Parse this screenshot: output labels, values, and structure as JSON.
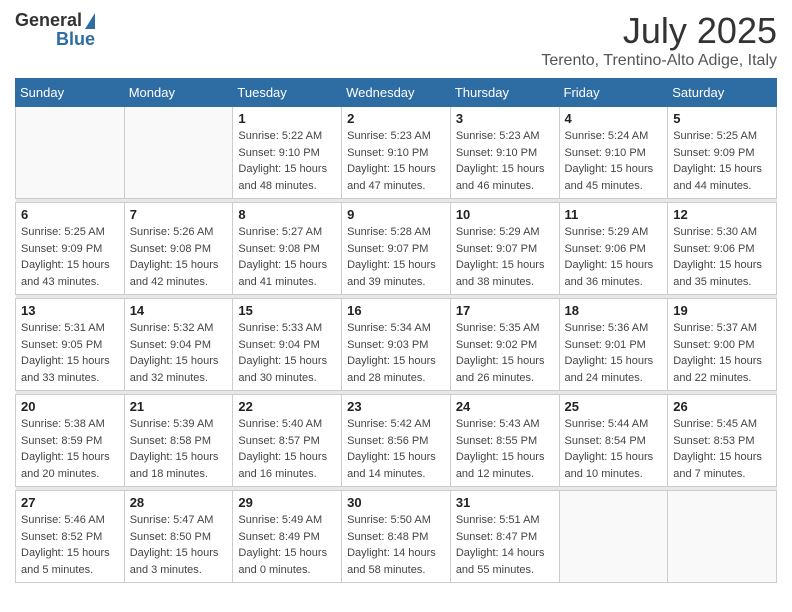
{
  "header": {
    "logo_general": "General",
    "logo_blue": "Blue",
    "month_title": "July 2025",
    "location": "Terento, Trentino-Alto Adige, Italy"
  },
  "days_of_week": [
    "Sunday",
    "Monday",
    "Tuesday",
    "Wednesday",
    "Thursday",
    "Friday",
    "Saturday"
  ],
  "weeks": [
    {
      "days": [
        {
          "num": "",
          "info": ""
        },
        {
          "num": "",
          "info": ""
        },
        {
          "num": "1",
          "info": "Sunrise: 5:22 AM\nSunset: 9:10 PM\nDaylight: 15 hours\nand 48 minutes."
        },
        {
          "num": "2",
          "info": "Sunrise: 5:23 AM\nSunset: 9:10 PM\nDaylight: 15 hours\nand 47 minutes."
        },
        {
          "num": "3",
          "info": "Sunrise: 5:23 AM\nSunset: 9:10 PM\nDaylight: 15 hours\nand 46 minutes."
        },
        {
          "num": "4",
          "info": "Sunrise: 5:24 AM\nSunset: 9:10 PM\nDaylight: 15 hours\nand 45 minutes."
        },
        {
          "num": "5",
          "info": "Sunrise: 5:25 AM\nSunset: 9:09 PM\nDaylight: 15 hours\nand 44 minutes."
        }
      ]
    },
    {
      "days": [
        {
          "num": "6",
          "info": "Sunrise: 5:25 AM\nSunset: 9:09 PM\nDaylight: 15 hours\nand 43 minutes."
        },
        {
          "num": "7",
          "info": "Sunrise: 5:26 AM\nSunset: 9:08 PM\nDaylight: 15 hours\nand 42 minutes."
        },
        {
          "num": "8",
          "info": "Sunrise: 5:27 AM\nSunset: 9:08 PM\nDaylight: 15 hours\nand 41 minutes."
        },
        {
          "num": "9",
          "info": "Sunrise: 5:28 AM\nSunset: 9:07 PM\nDaylight: 15 hours\nand 39 minutes."
        },
        {
          "num": "10",
          "info": "Sunrise: 5:29 AM\nSunset: 9:07 PM\nDaylight: 15 hours\nand 38 minutes."
        },
        {
          "num": "11",
          "info": "Sunrise: 5:29 AM\nSunset: 9:06 PM\nDaylight: 15 hours\nand 36 minutes."
        },
        {
          "num": "12",
          "info": "Sunrise: 5:30 AM\nSunset: 9:06 PM\nDaylight: 15 hours\nand 35 minutes."
        }
      ]
    },
    {
      "days": [
        {
          "num": "13",
          "info": "Sunrise: 5:31 AM\nSunset: 9:05 PM\nDaylight: 15 hours\nand 33 minutes."
        },
        {
          "num": "14",
          "info": "Sunrise: 5:32 AM\nSunset: 9:04 PM\nDaylight: 15 hours\nand 32 minutes."
        },
        {
          "num": "15",
          "info": "Sunrise: 5:33 AM\nSunset: 9:04 PM\nDaylight: 15 hours\nand 30 minutes."
        },
        {
          "num": "16",
          "info": "Sunrise: 5:34 AM\nSunset: 9:03 PM\nDaylight: 15 hours\nand 28 minutes."
        },
        {
          "num": "17",
          "info": "Sunrise: 5:35 AM\nSunset: 9:02 PM\nDaylight: 15 hours\nand 26 minutes."
        },
        {
          "num": "18",
          "info": "Sunrise: 5:36 AM\nSunset: 9:01 PM\nDaylight: 15 hours\nand 24 minutes."
        },
        {
          "num": "19",
          "info": "Sunrise: 5:37 AM\nSunset: 9:00 PM\nDaylight: 15 hours\nand 22 minutes."
        }
      ]
    },
    {
      "days": [
        {
          "num": "20",
          "info": "Sunrise: 5:38 AM\nSunset: 8:59 PM\nDaylight: 15 hours\nand 20 minutes."
        },
        {
          "num": "21",
          "info": "Sunrise: 5:39 AM\nSunset: 8:58 PM\nDaylight: 15 hours\nand 18 minutes."
        },
        {
          "num": "22",
          "info": "Sunrise: 5:40 AM\nSunset: 8:57 PM\nDaylight: 15 hours\nand 16 minutes."
        },
        {
          "num": "23",
          "info": "Sunrise: 5:42 AM\nSunset: 8:56 PM\nDaylight: 15 hours\nand 14 minutes."
        },
        {
          "num": "24",
          "info": "Sunrise: 5:43 AM\nSunset: 8:55 PM\nDaylight: 15 hours\nand 12 minutes."
        },
        {
          "num": "25",
          "info": "Sunrise: 5:44 AM\nSunset: 8:54 PM\nDaylight: 15 hours\nand 10 minutes."
        },
        {
          "num": "26",
          "info": "Sunrise: 5:45 AM\nSunset: 8:53 PM\nDaylight: 15 hours\nand 7 minutes."
        }
      ]
    },
    {
      "days": [
        {
          "num": "27",
          "info": "Sunrise: 5:46 AM\nSunset: 8:52 PM\nDaylight: 15 hours\nand 5 minutes."
        },
        {
          "num": "28",
          "info": "Sunrise: 5:47 AM\nSunset: 8:50 PM\nDaylight: 15 hours\nand 3 minutes."
        },
        {
          "num": "29",
          "info": "Sunrise: 5:49 AM\nSunset: 8:49 PM\nDaylight: 15 hours\nand 0 minutes."
        },
        {
          "num": "30",
          "info": "Sunrise: 5:50 AM\nSunset: 8:48 PM\nDaylight: 14 hours\nand 58 minutes."
        },
        {
          "num": "31",
          "info": "Sunrise: 5:51 AM\nSunset: 8:47 PM\nDaylight: 14 hours\nand 55 minutes."
        },
        {
          "num": "",
          "info": ""
        },
        {
          "num": "",
          "info": ""
        }
      ]
    }
  ]
}
